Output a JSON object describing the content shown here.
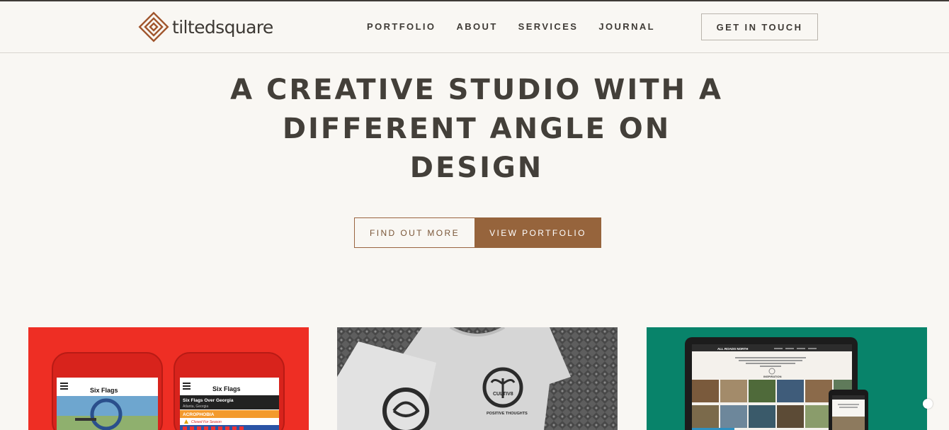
{
  "header": {
    "logo_text": "tiltedsquare",
    "nav": [
      "PORTFOLIO",
      "ABOUT",
      "SERVICES",
      "JOURNAL"
    ],
    "cta_label": "GET IN TOUCH"
  },
  "hero": {
    "title_lines": [
      "A CREATIVE STUDIO WITH A",
      "DIFFERENT ANGLE ON",
      "DESIGN"
    ],
    "button_outline": "FIND OUT MORE",
    "button_solid": "VIEW PORTFOLIO"
  },
  "portfolio": {
    "tile1": {
      "brand_left": "Six Flags",
      "brand_right": "Six Flags",
      "park_name": "Six Flags Over Georgia",
      "park_location": "Atlanta, Georgia",
      "ride_name": "ACROPHOBIA",
      "ride_status": "Closed For Season"
    },
    "tile2": {
      "brand": "CULTIV8",
      "tagline": "POSITIVE THOUGHTS"
    },
    "tile3": {
      "site_name": "ALL ROADS NORTH",
      "section": "INSPIRATION"
    }
  },
  "colors": {
    "accent": "#96643c",
    "background": "#f9f7f3",
    "text": "#423d36",
    "tile1": "#ee2e24",
    "tile3": "#08836a"
  },
  "icons": {
    "logo": "tilted-square-logo-icon",
    "scroll": "scroll-indicator-icon"
  }
}
